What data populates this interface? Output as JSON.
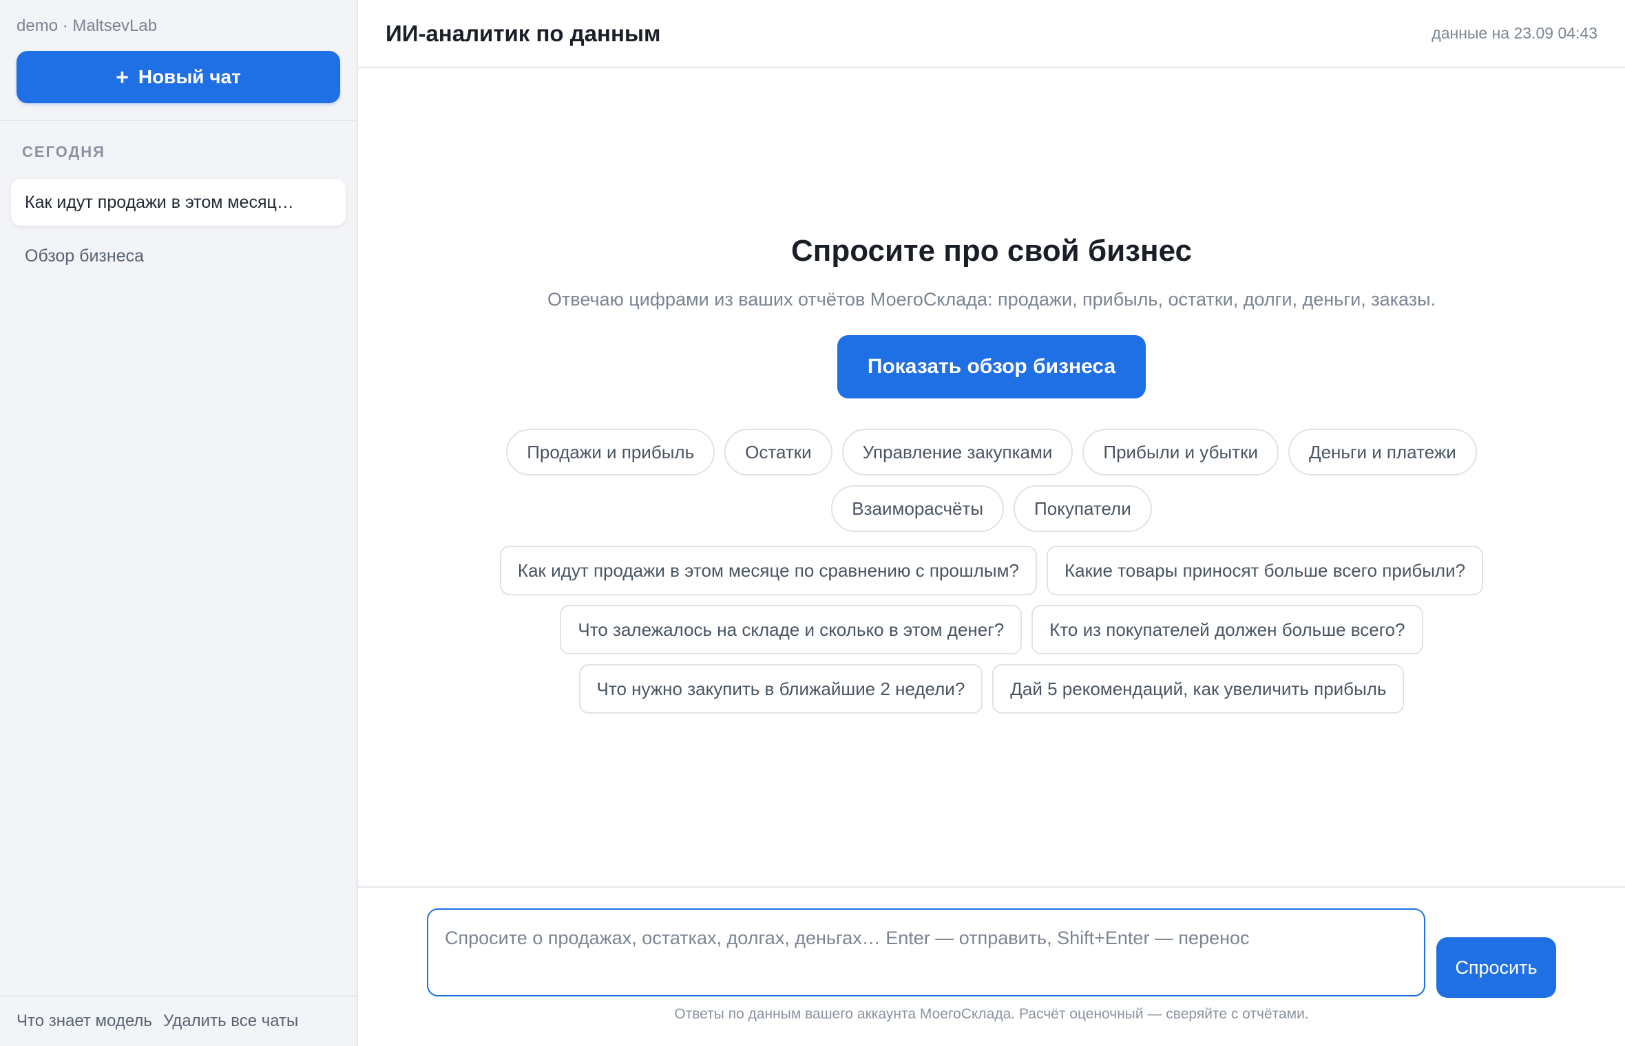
{
  "sidebar": {
    "account": "demo · MaltsevLab",
    "new_chat_icon": "+",
    "new_chat_label": "Новый чат",
    "section_today": "СЕГОДНЯ",
    "chats": [
      {
        "label": "Как идут продажи в этом месяц…",
        "active": true
      },
      {
        "label": "Обзор бизнеса",
        "active": false
      }
    ],
    "footer": {
      "model_info": "Что знает модель",
      "delete_all": "Удалить все чаты"
    }
  },
  "header": {
    "title": "ИИ-аналитик по данным",
    "data_date": "данные на 23.09 04:43"
  },
  "hero": {
    "title": "Спросите про свой бизнес",
    "subtitle": "Отвечаю цифрами из ваших отчётов МоегоСклада: продажи, прибыль, остатки, долги, деньги, заказы.",
    "overview_button": "Показать обзор бизнеса",
    "topics": [
      "Продажи и прибыль",
      "Остатки",
      "Управление закупками",
      "Прибыли и убытки",
      "Деньги и платежи",
      "Взаиморасчёты",
      "Покупатели"
    ],
    "questions": [
      "Как идут продажи в этом месяце по сравнению с прошлым?",
      "Какие товары приносят больше всего прибыли?",
      "Что залежалось на складе и сколько в этом денег?",
      "Кто из покупателей должен больше всего?",
      "Что нужно закупить в ближайшие 2 недели?",
      "Дай 5 рекомендаций, как увеличить прибыль"
    ]
  },
  "composer": {
    "placeholder": "Спросите о продажах, остатках, долгах, деньгах… Enter — отправить, Shift+Enter — перенос",
    "value": "",
    "ask_button": "Спросить",
    "disclaimer": "Ответы по данным вашего аккаунта МоегоСклада. Расчёт оценочный — сверяйте с отчётами."
  },
  "colors": {
    "accent": "#1f6fe5",
    "sidebar_bg": "#f2f4f7",
    "border": "#e3e7ec",
    "muted_text": "#7b8592"
  }
}
